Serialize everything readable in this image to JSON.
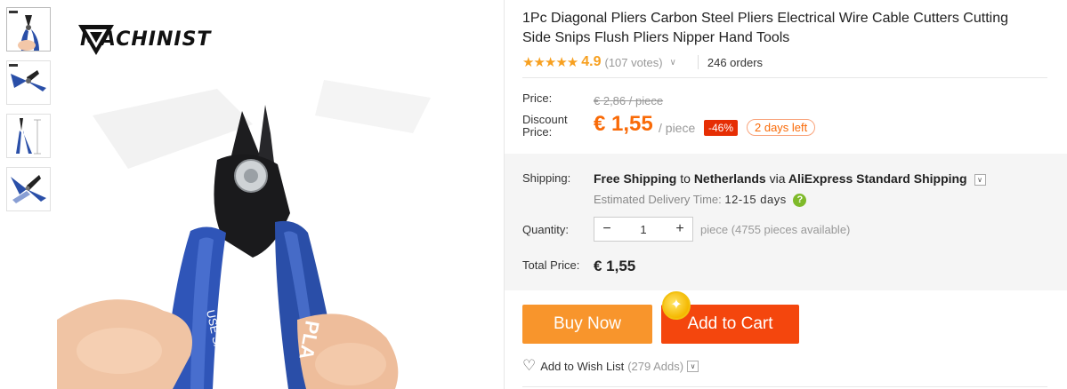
{
  "thumbnails": [
    {
      "name": "thumb-1",
      "active": true
    },
    {
      "name": "thumb-2",
      "active": false
    },
    {
      "name": "thumb-3",
      "active": false
    },
    {
      "name": "thumb-4",
      "active": false
    }
  ],
  "main_image": {
    "brand": "MACHINIST"
  },
  "product": {
    "title": "1Pc Diagonal Pliers Carbon Steel Pliers Electrical Wire Cable Cutters Cutting Side Snips Flush Pliers Nipper Hand Tools",
    "stars": "★★★★★",
    "rating": "4.9",
    "votes": "(107 votes)",
    "orders": "246 orders"
  },
  "price": {
    "label": "Price:",
    "original": "€ 2,86 / piece",
    "discount_label": "Discount Price:",
    "discount": "€ 1,55",
    "per_piece": "/ piece",
    "discount_badge": "-46%",
    "days_left": "2 days left"
  },
  "shipping": {
    "label": "Shipping:",
    "free_text": "Free Shipping",
    "to_text": "to",
    "country": "Netherlands",
    "via_text": "via",
    "method": "AliExpress Standard Shipping",
    "estimated_label": "Estimated Delivery Time:",
    "estimated_value": "12-15 days"
  },
  "quantity": {
    "label": "Quantity:",
    "value": "1",
    "minus": "−",
    "plus": "+",
    "available": "piece (4755 pieces available)"
  },
  "total": {
    "label": "Total Price:",
    "value": "€ 1,55"
  },
  "actions": {
    "buy_now": "Buy Now",
    "add_to_cart": "Add to Cart",
    "wishlist": "Add to Wish List",
    "wishlist_count": "(279 Adds)"
  },
  "colors": {
    "accent_orange": "#f96a07",
    "buy_now_bg": "#f8952c",
    "add_cart_bg": "#f4460d",
    "discount_badge_bg": "#e62e04",
    "star": "#f7a020",
    "help_icon": "#7fba2a"
  }
}
